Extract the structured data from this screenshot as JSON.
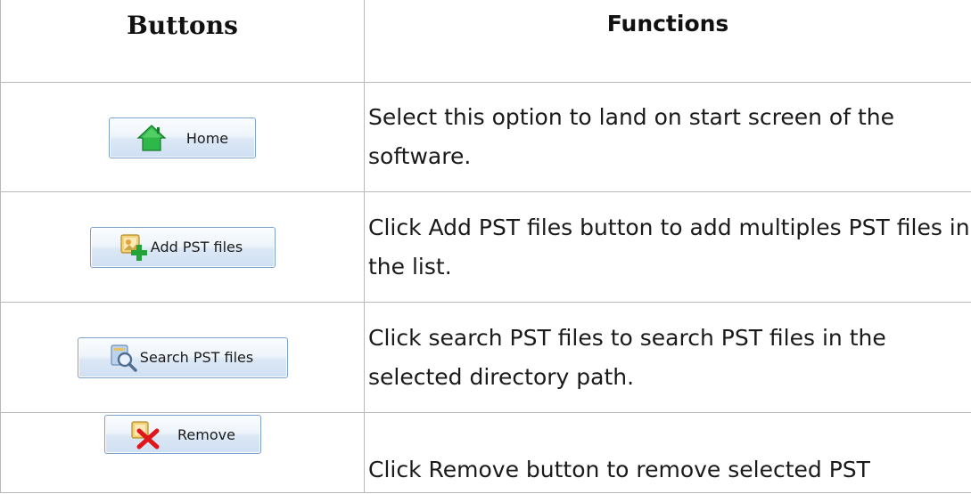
{
  "table": {
    "header": {
      "buttons": "Buttons",
      "functions": "Functions"
    },
    "rows": [
      {
        "button_label": "Home",
        "icon": "home-icon",
        "description": "Select this option to land on start screen of the software."
      },
      {
        "button_label": "Add PST files",
        "icon": "add-pst-files-icon",
        "description": "Click Add PST files button to add multiples PST files in the list."
      },
      {
        "button_label": "Search PST files",
        "icon": "search-pst-files-icon",
        "description": "Click search PST files to search PST files in the selected directory path."
      },
      {
        "button_label": "Remove",
        "icon": "remove-icon",
        "description": "Click Remove button to remove selected PST"
      }
    ]
  },
  "colors": {
    "button_border": "#7da2ce",
    "home_icon_green": "#2fb84a",
    "remove_icon_red": "#e0161b"
  }
}
